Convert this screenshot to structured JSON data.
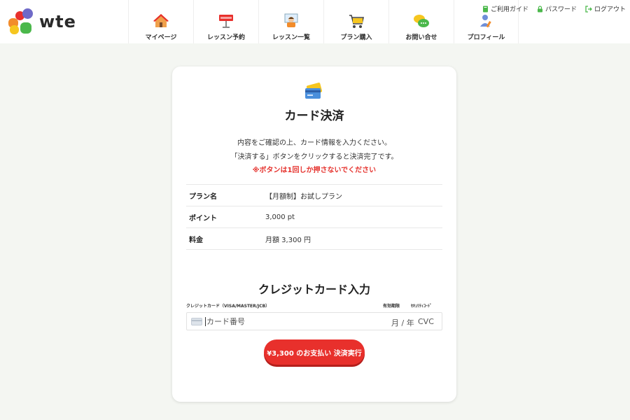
{
  "brand": {
    "name": "wte"
  },
  "nav": {
    "items": [
      {
        "label": "マイページ",
        "icon": "house-icon"
      },
      {
        "label": "レッスン予約",
        "icon": "reservation-sign-icon"
      },
      {
        "label": "レッスン一覧",
        "icon": "teacher-icon"
      },
      {
        "label": "プラン購入",
        "icon": "shopping-cart-icon"
      },
      {
        "label": "お問い合せ",
        "icon": "chat-bubbles-icon"
      },
      {
        "label": "プロフィール",
        "icon": "profile-icon"
      }
    ]
  },
  "utility": {
    "guide": "ご利用ガイド",
    "password": "パスワード",
    "logout": "ログアウト"
  },
  "payment": {
    "title": "カード決済",
    "message_1": "内容をご確認の上、カード情報を入力ください。",
    "message_2": "「決済する」ボタンをクリックすると決済完了です。",
    "warning": "※ボタンは1回しか押さないでください",
    "details": [
      {
        "key": "プラン名",
        "value": "【月額制】お試しプラン"
      },
      {
        "key": "ポイント",
        "value": "3,000 pt"
      },
      {
        "key": "料金",
        "value": "月額 3,300 円"
      }
    ]
  },
  "credit_card": {
    "title": "クレジットカード入力",
    "label_card": "クレジットカード（VISA/MASTER/JCB）",
    "label_expiry": "有効期限",
    "label_cvc": "ｾｷｭﾘﾃｨｺｰﾄﾞ",
    "number_placeholder": "カード番号",
    "expiry_placeholder": "月 / 年",
    "cvc_placeholder": "CVC"
  },
  "pay_button": {
    "label": "¥3,300 のお支払い 決済実行"
  },
  "colors": {
    "accent_red": "#e8302c",
    "background": "#f4f6f2",
    "warning_text": "#e5322d"
  }
}
